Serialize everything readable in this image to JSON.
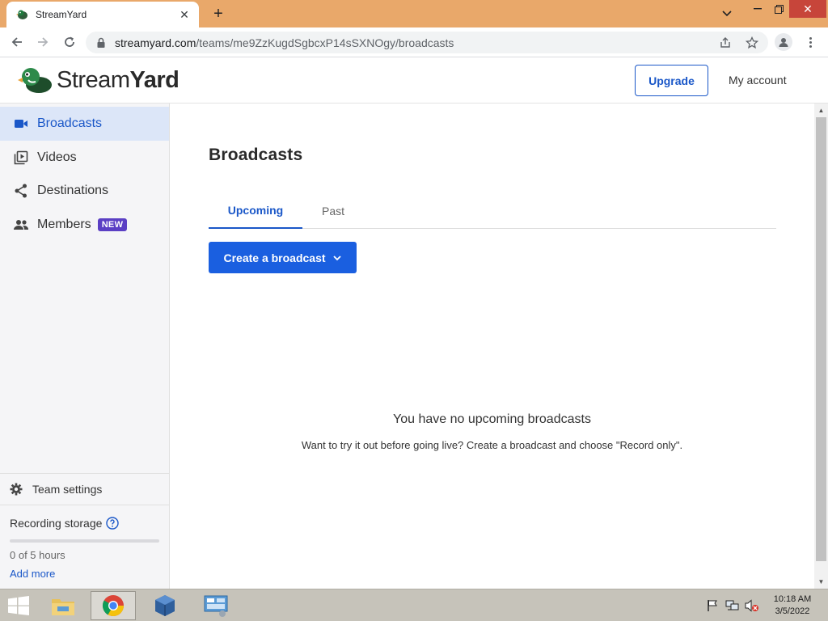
{
  "browser": {
    "tab_title": "StreamYard",
    "url_host": "streamyard.com",
    "url_path": "/teams/me9ZzKugdSgbcxP14sSXNOgy/broadcasts"
  },
  "header": {
    "logo_text_light": "Stream",
    "logo_text_bold": "Yard",
    "upgrade_label": "Upgrade",
    "account_label": "My account"
  },
  "sidebar": {
    "items": [
      {
        "label": "Broadcasts",
        "icon": "video-camera-icon",
        "active": true
      },
      {
        "label": "Videos",
        "icon": "video-library-icon",
        "active": false
      },
      {
        "label": "Destinations",
        "icon": "share-icon",
        "active": false
      },
      {
        "label": "Members",
        "icon": "people-icon",
        "active": false,
        "badge": "NEW"
      }
    ],
    "team_settings_label": "Team settings",
    "storage_label": "Recording storage",
    "storage_used": "0 of 5 hours",
    "storage_fraction": 0,
    "add_more_label": "Add more"
  },
  "main": {
    "title": "Broadcasts",
    "tabs": [
      {
        "label": "Upcoming",
        "active": true
      },
      {
        "label": "Past",
        "active": false
      }
    ],
    "create_button_label": "Create a broadcast",
    "empty_title": "You have no upcoming broadcasts",
    "empty_hint": "Want to try it out before going live? Create a broadcast and choose \"Record only\"."
  },
  "taskbar": {
    "time": "10:18 AM",
    "date": "3/5/2022"
  },
  "colors": {
    "accent": "#1a57c8",
    "button_primary": "#1a5fe0",
    "badge": "#5b3fc4",
    "titlebar": "#e9a86a"
  }
}
